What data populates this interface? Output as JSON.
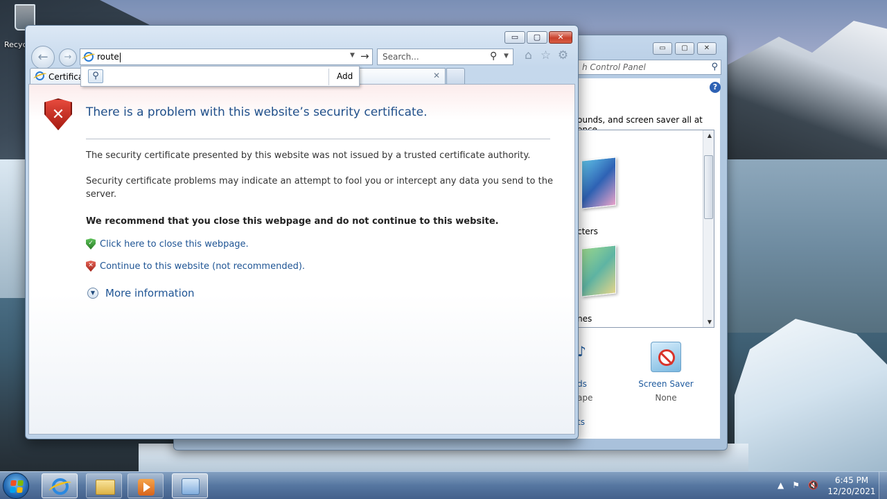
{
  "desktop": {
    "recycle_bin_label": "Recyc"
  },
  "control_panel": {
    "search_placeholder": "h Control Panel",
    "description": "ounds, and screen saver all at once.",
    "theme_label_1": "cters",
    "theme_label_2": "nes",
    "sounds_label": "ds",
    "sounds_sub": "ape",
    "screen_saver_label": "Screen Saver",
    "screen_saver_value": "None",
    "bottom_link": "ts",
    "window_buttons": [
      "▭",
      "▢",
      "✕"
    ]
  },
  "browser": {
    "window_buttons": {
      "minimize": "▭",
      "restore": "▢",
      "close": "✕"
    },
    "address_value": "route",
    "search_placeholder": "Search...",
    "tab_title": "Certificate Error: Navigation Blocked",
    "autocomplete": {
      "add_label": "Add"
    },
    "page": {
      "title": "There is a problem with this website’s security certificate.",
      "para1": "The security certificate presented by this website was not issued by a trusted certificate authority.",
      "para2": "Security certificate problems may indicate an attempt to fool you or intercept any data you send to the server.",
      "recommendation": "We recommend that you close this webpage and do not continue to this website.",
      "close_link": "Click here to close this webpage.",
      "continue_link": "Continue to this website (not recommended).",
      "more_info": "More information"
    }
  },
  "taskbar": {
    "time": "6:45 PM",
    "date": "12/20/2021",
    "pinned": [
      "internet-explorer",
      "windows-explorer",
      "media-player",
      "control-panel"
    ]
  },
  "colors": {
    "link_blue": "#1e5494",
    "title_blue": "#1f4f8a",
    "error_red": "#c9412c"
  }
}
